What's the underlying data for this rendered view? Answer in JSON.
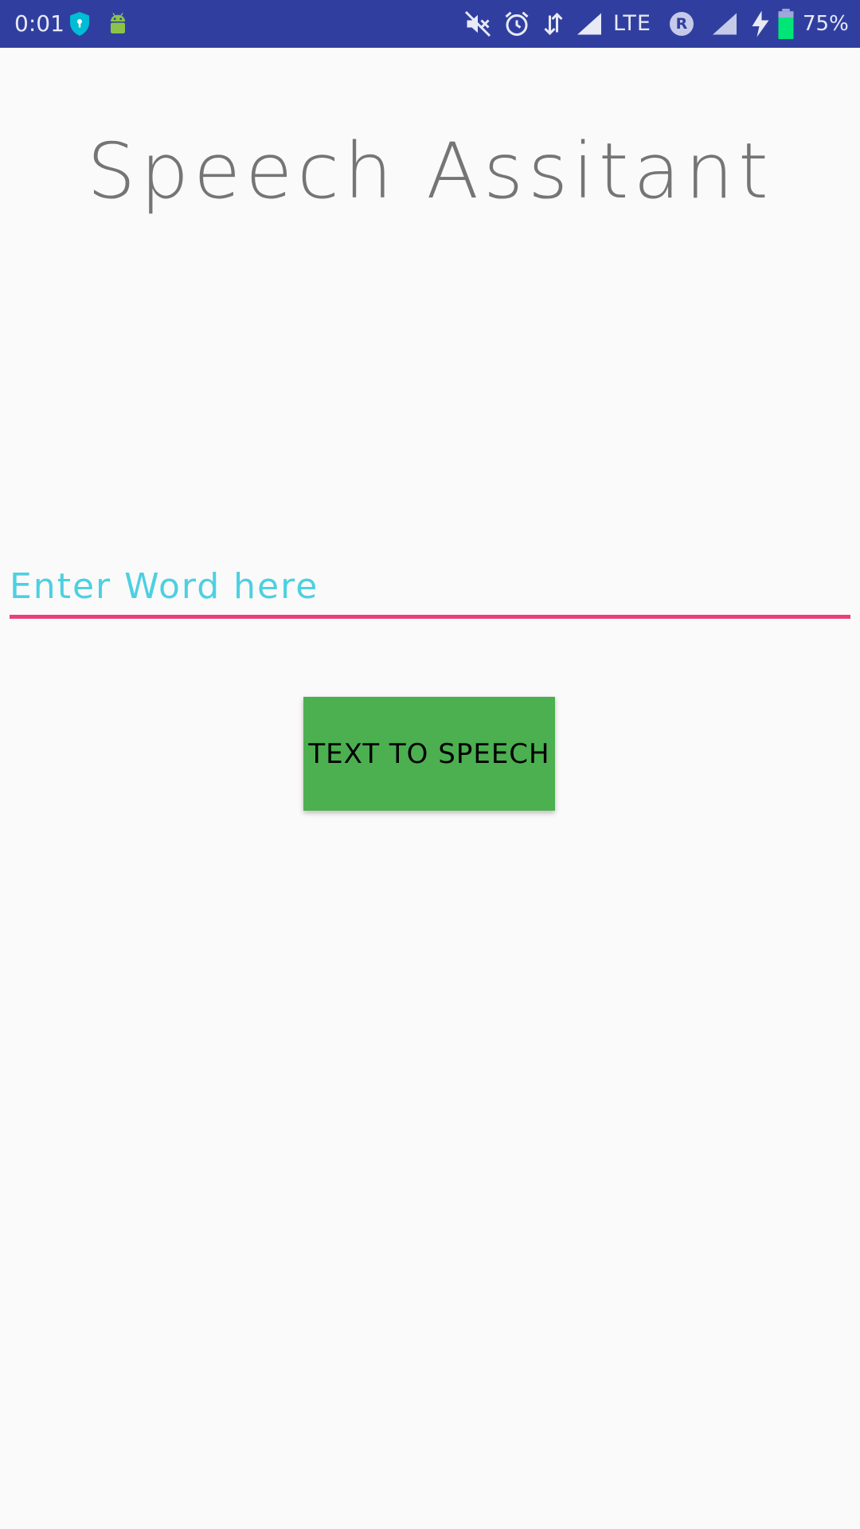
{
  "status_bar": {
    "time": "0:01",
    "network_type": "LTE",
    "roaming_indicator": "R",
    "battery_percent": "75%",
    "icons": [
      "vpn-shield-icon",
      "android-debug-icon",
      "mute-icon",
      "alarm-icon",
      "data-arrows-icon",
      "signal-icon",
      "signal-roaming-icon",
      "charging-bolt-icon",
      "battery-icon"
    ],
    "colors": {
      "background": "#303f9f",
      "battery_fill": "#00e676",
      "shield": "#00bcd4",
      "android": "#8bc34a"
    }
  },
  "main": {
    "title": "Speech Assitant",
    "word_input": {
      "placeholder": "Enter Word here",
      "value": ""
    },
    "tts_button_label": "TEXT TO SPEECH"
  },
  "colors": {
    "background": "#fafafa",
    "title": "#757575",
    "placeholder": "#4dd0e1",
    "input_underline": "#ec407a",
    "button": "#4caf50"
  }
}
